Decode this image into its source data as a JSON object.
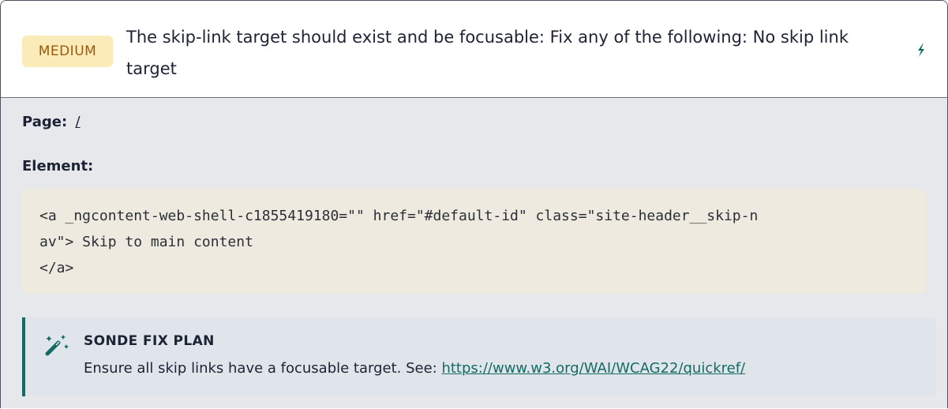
{
  "issue": {
    "severity": "MEDIUM",
    "title": "The skip-link target should exist and be focusable: Fix any of the following: No skip link target",
    "action_icon": "bolt-icon"
  },
  "details": {
    "page_label": "Page:",
    "page_link": "/",
    "element_label": "Element:",
    "element_code": "<a _ngcontent-web-shell-c1855419180=\"\" href=\"#default-id\" class=\"site-header__skip-n\nav\"> Skip to main content\n</a>"
  },
  "fix_plan": {
    "icon": "magic-wand-icon",
    "heading": "SONDE FIX PLAN",
    "text": "Ensure all skip links have a focusable target. See: ",
    "link": "https://www.w3.org/WAI/WCAG22/quickref/"
  },
  "colors": {
    "severity_bg": "#fbebb8",
    "severity_text": "#9a5a0d",
    "accent": "#146b63",
    "code_bg": "#eeeae0",
    "panel_bg": "#e6e8ec"
  }
}
